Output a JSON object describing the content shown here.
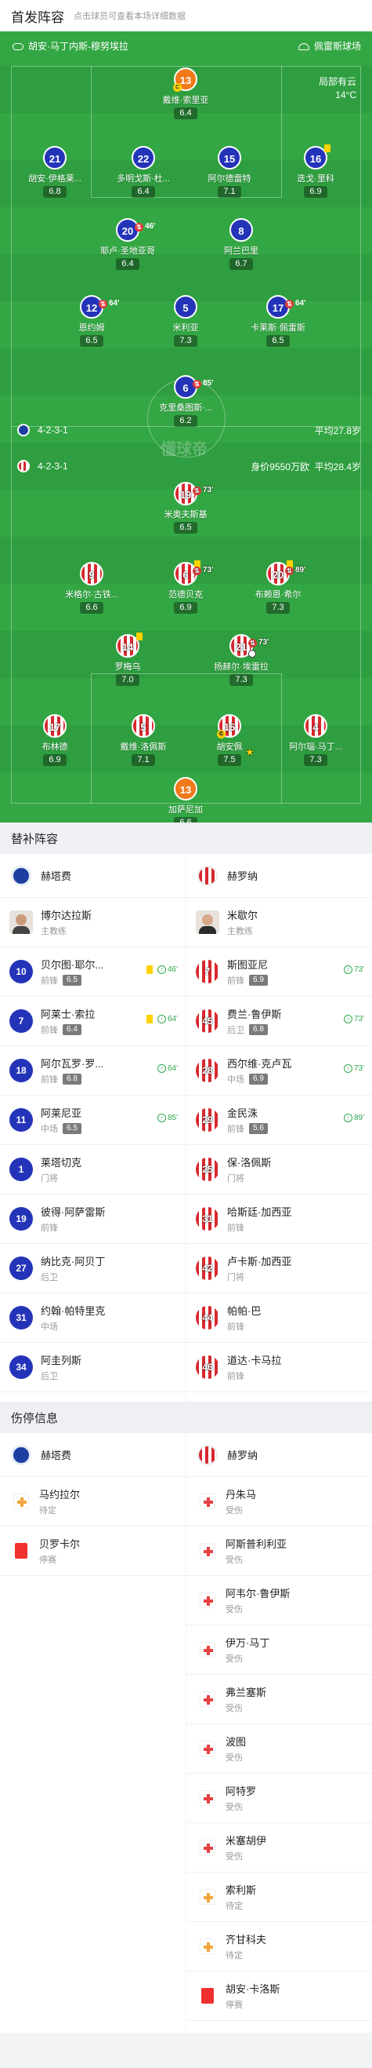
{
  "header": {
    "title": "首发阵容",
    "subtitle": "点击球员可查看本场详细数据"
  },
  "pitch": {
    "coach": "胡安·马丁内斯-穆努埃拉",
    "stadium": "佩雷斯球场",
    "weather": "局部有云",
    "temp": "14°C",
    "watermark": "懂球帝",
    "home": {
      "formation": "4-2-3-1",
      "avg_age": "平均27.8岁"
    },
    "away": {
      "formation": "4-2-3-1",
      "value": "身价9550万欧",
      "avg_age": "平均28.4岁"
    }
  },
  "home_players": [
    {
      "num": "13",
      "name": "戴维·索里亚",
      "rating": "6.4",
      "color": "orange",
      "captain": true
    },
    {
      "num": "21",
      "name": "胡安·伊格莱...",
      "rating": "6.8"
    },
    {
      "num": "22",
      "name": "多明戈斯·杜...",
      "rating": "6.4"
    },
    {
      "num": "15",
      "name": "阿尔德雷特",
      "rating": "7.1"
    },
    {
      "num": "16",
      "name": "迭戈·里科",
      "rating": "6.9",
      "yellow": true
    },
    {
      "num": "20",
      "name": "耶卢·圣地亚哥",
      "rating": "6.4",
      "sub": "46'"
    },
    {
      "num": "8",
      "name": "阿兰巴里",
      "rating": "6.7"
    },
    {
      "num": "12",
      "name": "恩约姆",
      "rating": "6.5",
      "sub": "64'"
    },
    {
      "num": "5",
      "name": "米利亚",
      "rating": "7.3"
    },
    {
      "num": "17",
      "name": "卡莱斯·佩雷斯",
      "rating": "6.5",
      "sub": "64'"
    },
    {
      "num": "6",
      "name": "克里桑图斯·...",
      "rating": "6.2",
      "sub": "85'"
    }
  ],
  "away_players": [
    {
      "num": "19",
      "name": "米奥夫斯基",
      "rating": "6.5",
      "sub": "73'"
    },
    {
      "num": "9",
      "name": "米格尔·古铁...",
      "rating": "6.6"
    },
    {
      "num": "6",
      "name": "范德贝克",
      "rating": "6.9",
      "sub": "73'",
      "yellow": true
    },
    {
      "num": "20",
      "name": "布赖恩·希尔",
      "rating": "7.3",
      "sub": "89'",
      "yellow": true
    },
    {
      "num": "14",
      "name": "罗梅乌",
      "rating": "7.0",
      "yellow": true
    },
    {
      "num": "21",
      "name": "扬赫尔·埃雷拉",
      "rating": "7.3",
      "sub": "73'",
      "ball": true
    },
    {
      "num": "17",
      "name": "布林德",
      "rating": "6.9"
    },
    {
      "num": "5",
      "name": "戴维·洛佩斯",
      "rating": "7.1"
    },
    {
      "num": "15",
      "name": "胡安佩",
      "rating": "7.5",
      "star": true,
      "captain": true
    },
    {
      "num": "4",
      "name": "阿尔瑙·马丁...",
      "rating": "7.3"
    },
    {
      "num": "13",
      "name": "加萨尼加",
      "rating": "6.6",
      "color": "orange"
    }
  ],
  "subs": {
    "title": "替补阵容",
    "home_team": "赫塔费",
    "away_team": "赫罗纳",
    "home_coach": {
      "name": "博尔达拉斯",
      "role": "主教练"
    },
    "away_coach": {
      "name": "米歇尔",
      "role": "主教练"
    },
    "home": [
      {
        "num": "10",
        "name": "贝尔图·耶尔...",
        "pos": "前锋",
        "score": "6.5",
        "time": "46'",
        "yellow": true
      },
      {
        "num": "7",
        "name": "阿莱士·索拉",
        "pos": "前锋",
        "score": "6.4",
        "time": "64'",
        "yellow": true
      },
      {
        "num": "18",
        "name": "阿尔瓦罗·罗...",
        "pos": "前锋",
        "score": "6.8",
        "time": "64'"
      },
      {
        "num": "11",
        "name": "阿莱尼亚",
        "pos": "中场",
        "score": "6.5",
        "time": "85'"
      },
      {
        "num": "1",
        "name": "莱塔切克",
        "pos": "门将"
      },
      {
        "num": "19",
        "name": "彼得·阿萨雷斯",
        "pos": "前锋"
      },
      {
        "num": "27",
        "name": "纳比克·阿贝丁",
        "pos": "后卫"
      },
      {
        "num": "31",
        "name": "约翰·帕特里克",
        "pos": "中场"
      },
      {
        "num": "34",
        "name": "阿圭列斯",
        "pos": "后卫"
      }
    ],
    "away": [
      {
        "num": "7",
        "name": "斯图亚尼",
        "pos": "前锋",
        "score": "6.9",
        "time": "73'"
      },
      {
        "num": "45",
        "name": "费兰·鲁伊斯",
        "pos": "后卫",
        "score": "6.8",
        "time": "73'"
      },
      {
        "num": "28",
        "name": "西尔维·克卢瓦",
        "pos": "中场",
        "score": "6.9",
        "time": "73'"
      },
      {
        "num": "29",
        "name": "金民洙",
        "pos": "前锋",
        "score": "5.6",
        "time": "89'"
      },
      {
        "num": "25",
        "name": "保·洛佩斯",
        "pos": "门将"
      },
      {
        "num": "31",
        "name": "哈斯廷·加西亚",
        "pos": "前锋"
      },
      {
        "num": "42",
        "name": "卢卡斯·加西亚",
        "pos": "门将"
      },
      {
        "num": "44",
        "name": "帕帕·巴",
        "pos": "前锋"
      },
      {
        "num": "46",
        "name": "道达·卡马拉",
        "pos": "前锋"
      }
    ]
  },
  "injuries": {
    "title": "伤停信息",
    "home_team": "赫塔费",
    "away_team": "赫罗纳",
    "home": [
      {
        "name": "马约拉尔",
        "status": "待定",
        "type": "doubt"
      },
      {
        "name": "贝罗卡尔",
        "status": "停赛",
        "type": "red"
      }
    ],
    "away": [
      {
        "name": "丹朱马",
        "status": "受伤",
        "type": "injury"
      },
      {
        "name": "阿斯普利利亚",
        "status": "受伤",
        "type": "injury"
      },
      {
        "name": "阿韦尔·鲁伊斯",
        "status": "受伤",
        "type": "injury"
      },
      {
        "name": "伊万·马丁",
        "status": "受伤",
        "type": "injury"
      },
      {
        "name": "弗兰塞斯",
        "status": "受伤",
        "type": "injury"
      },
      {
        "name": "波图",
        "status": "受伤",
        "type": "injury"
      },
      {
        "name": "阿特罗",
        "status": "受伤",
        "type": "injury"
      },
      {
        "name": "米塞胡伊",
        "status": "受伤",
        "type": "injury"
      },
      {
        "name": "索利斯",
        "status": "待定",
        "type": "doubt"
      },
      {
        "name": "齐甘科夫",
        "status": "待定",
        "type": "doubt"
      },
      {
        "name": "胡安·卡洛斯",
        "status": "停赛",
        "type": "red"
      }
    ]
  }
}
